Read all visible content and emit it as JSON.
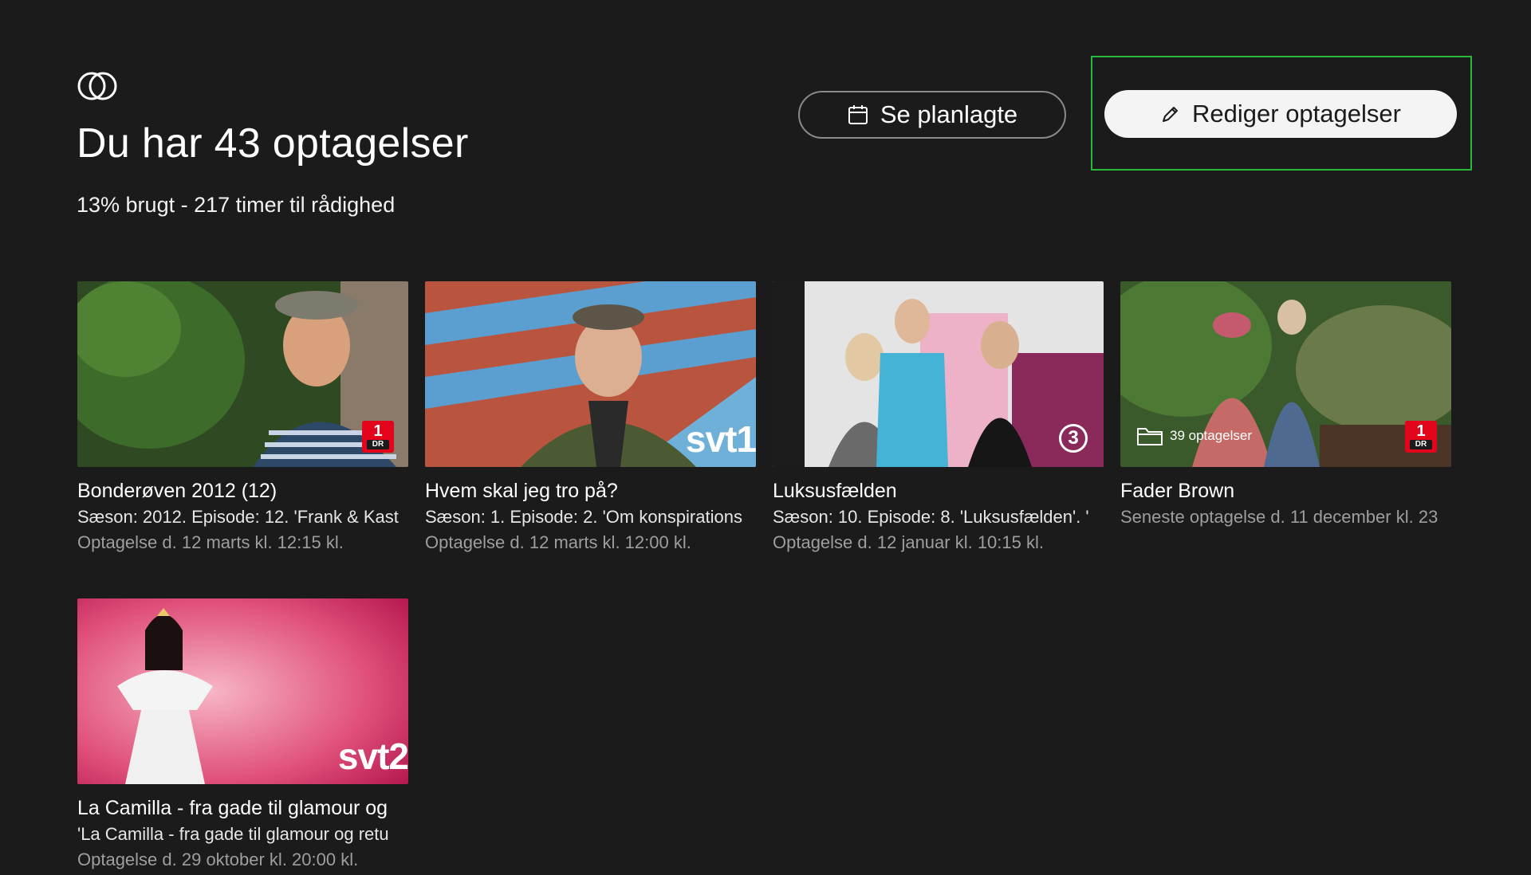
{
  "header": {
    "title": "Du har 43 optagelser",
    "usage": "13% brugt - 217 timer til rådighed"
  },
  "buttons": {
    "scheduled": "Se planlagte",
    "edit": "Rediger optagelser"
  },
  "icons": [
    "logo-icon",
    "calendar-icon",
    "pencil-icon",
    "folder-icon"
  ],
  "recordings": [
    {
      "title": "Bonderøven 2012 (12)",
      "subtitle": "Sæson: 2012. Episode: 12. 'Frank & Kast",
      "date": "Optagelse d. 12 marts kl. 12:15 kl.",
      "channel_badge": "1",
      "channel_sub": "DR"
    },
    {
      "title": "Hvem skal jeg tro på?",
      "subtitle": "Sæson: 1. Episode: 2. 'Om konspirations",
      "date": "Optagelse d. 12 marts kl. 12:00 kl.",
      "channel_badge": "svt1"
    },
    {
      "title": "Luksusfælden",
      "subtitle": "Sæson: 10. Episode: 8. 'Luksusfælden'. '",
      "date": "Optagelse d. 12 januar kl. 10:15 kl.",
      "channel_badge": "3"
    },
    {
      "title": "Fader Brown",
      "subtitle": "Seneste optagelse d. 11 december kl. 23",
      "folder_label": "39 optagelser",
      "channel_badge": "1",
      "channel_sub": "DR"
    },
    {
      "title": "La Camilla - fra gade til glamour og",
      "subtitle": "'La Camilla - fra gade til glamour og retu",
      "date": "Optagelse d. 29 oktober kl. 20:00 kl.",
      "channel_badge": "svt2"
    }
  ],
  "colors": {
    "background": "#1b1b1b",
    "focus": "#27b83c",
    "dr_red": "#e3051b"
  }
}
